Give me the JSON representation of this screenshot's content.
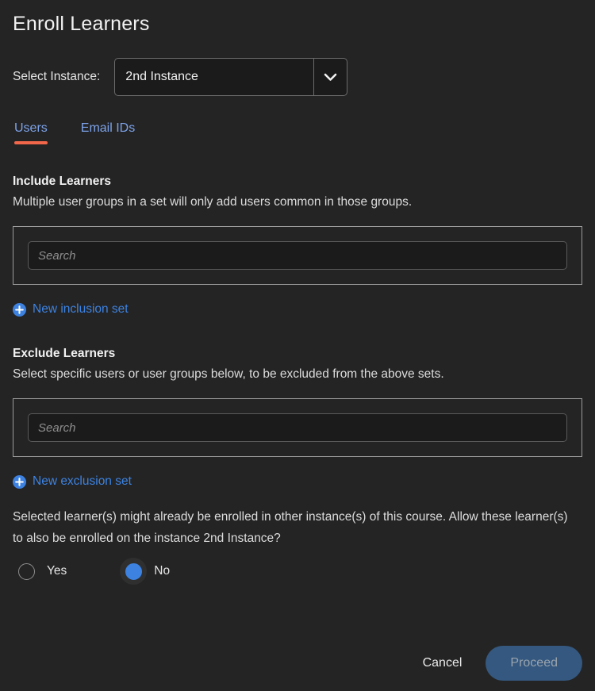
{
  "dialog": {
    "title": "Enroll Learners"
  },
  "instance": {
    "label": "Select Instance:",
    "selected": "2nd Instance",
    "chevron_icon": "chevron-down-icon"
  },
  "tabs": [
    {
      "label": "Users",
      "active": true
    },
    {
      "label": "Email IDs",
      "active": false
    }
  ],
  "include": {
    "heading": "Include Learners",
    "description": "Multiple user groups in a set will only add users common in those groups.",
    "search_placeholder": "Search",
    "search_value": "",
    "add_set_label": "New inclusion set",
    "add_set_icon": "plus-circle-icon"
  },
  "exclude": {
    "heading": "Exclude Learners",
    "description": "Select specific users or user groups below, to be excluded from the above sets.",
    "search_placeholder": "Search",
    "search_value": "",
    "add_set_label": "New exclusion set",
    "add_set_icon": "plus-circle-icon"
  },
  "allow_enrollment": {
    "question": "Selected learner(s) might already be enrolled in other instance(s) of this course. Allow these learner(s) to also be enrolled on the instance 2nd Instance?",
    "options": [
      {
        "label": "Yes",
        "selected": false
      },
      {
        "label": "No",
        "selected": true
      }
    ]
  },
  "footer": {
    "cancel_label": "Cancel",
    "proceed_label": "Proceed",
    "proceed_disabled": true
  },
  "colors": {
    "background": "#242424",
    "accent_orange": "#f2674a",
    "link_blue": "#3d82e0",
    "tab_blue": "#7ca2e8",
    "proceed_bg": "#34587f"
  }
}
